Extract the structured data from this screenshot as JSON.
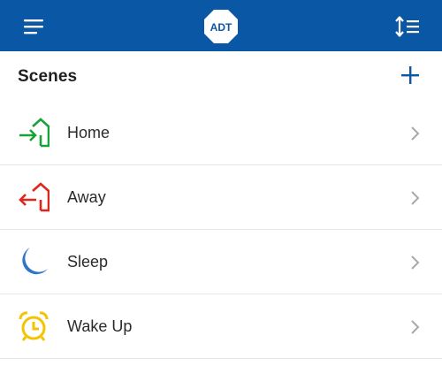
{
  "header": {
    "logo_text": "ADT",
    "menu_icon": "hamburger-menu-icon",
    "sort_icon": "sort-icon",
    "brand_color": "#0a57a6"
  },
  "scenes": {
    "title": "Scenes",
    "add_icon": "plus-icon",
    "items": [
      {
        "label": "Home",
        "icon": "arrive-home-icon",
        "color": "#1aa23a"
      },
      {
        "label": "Away",
        "icon": "leave-home-icon",
        "color": "#e0261b"
      },
      {
        "label": "Sleep",
        "icon": "moon-icon",
        "color": "#2f76c9"
      },
      {
        "label": "Wake Up",
        "icon": "alarm-clock-icon",
        "color": "#f5c400"
      }
    ]
  }
}
